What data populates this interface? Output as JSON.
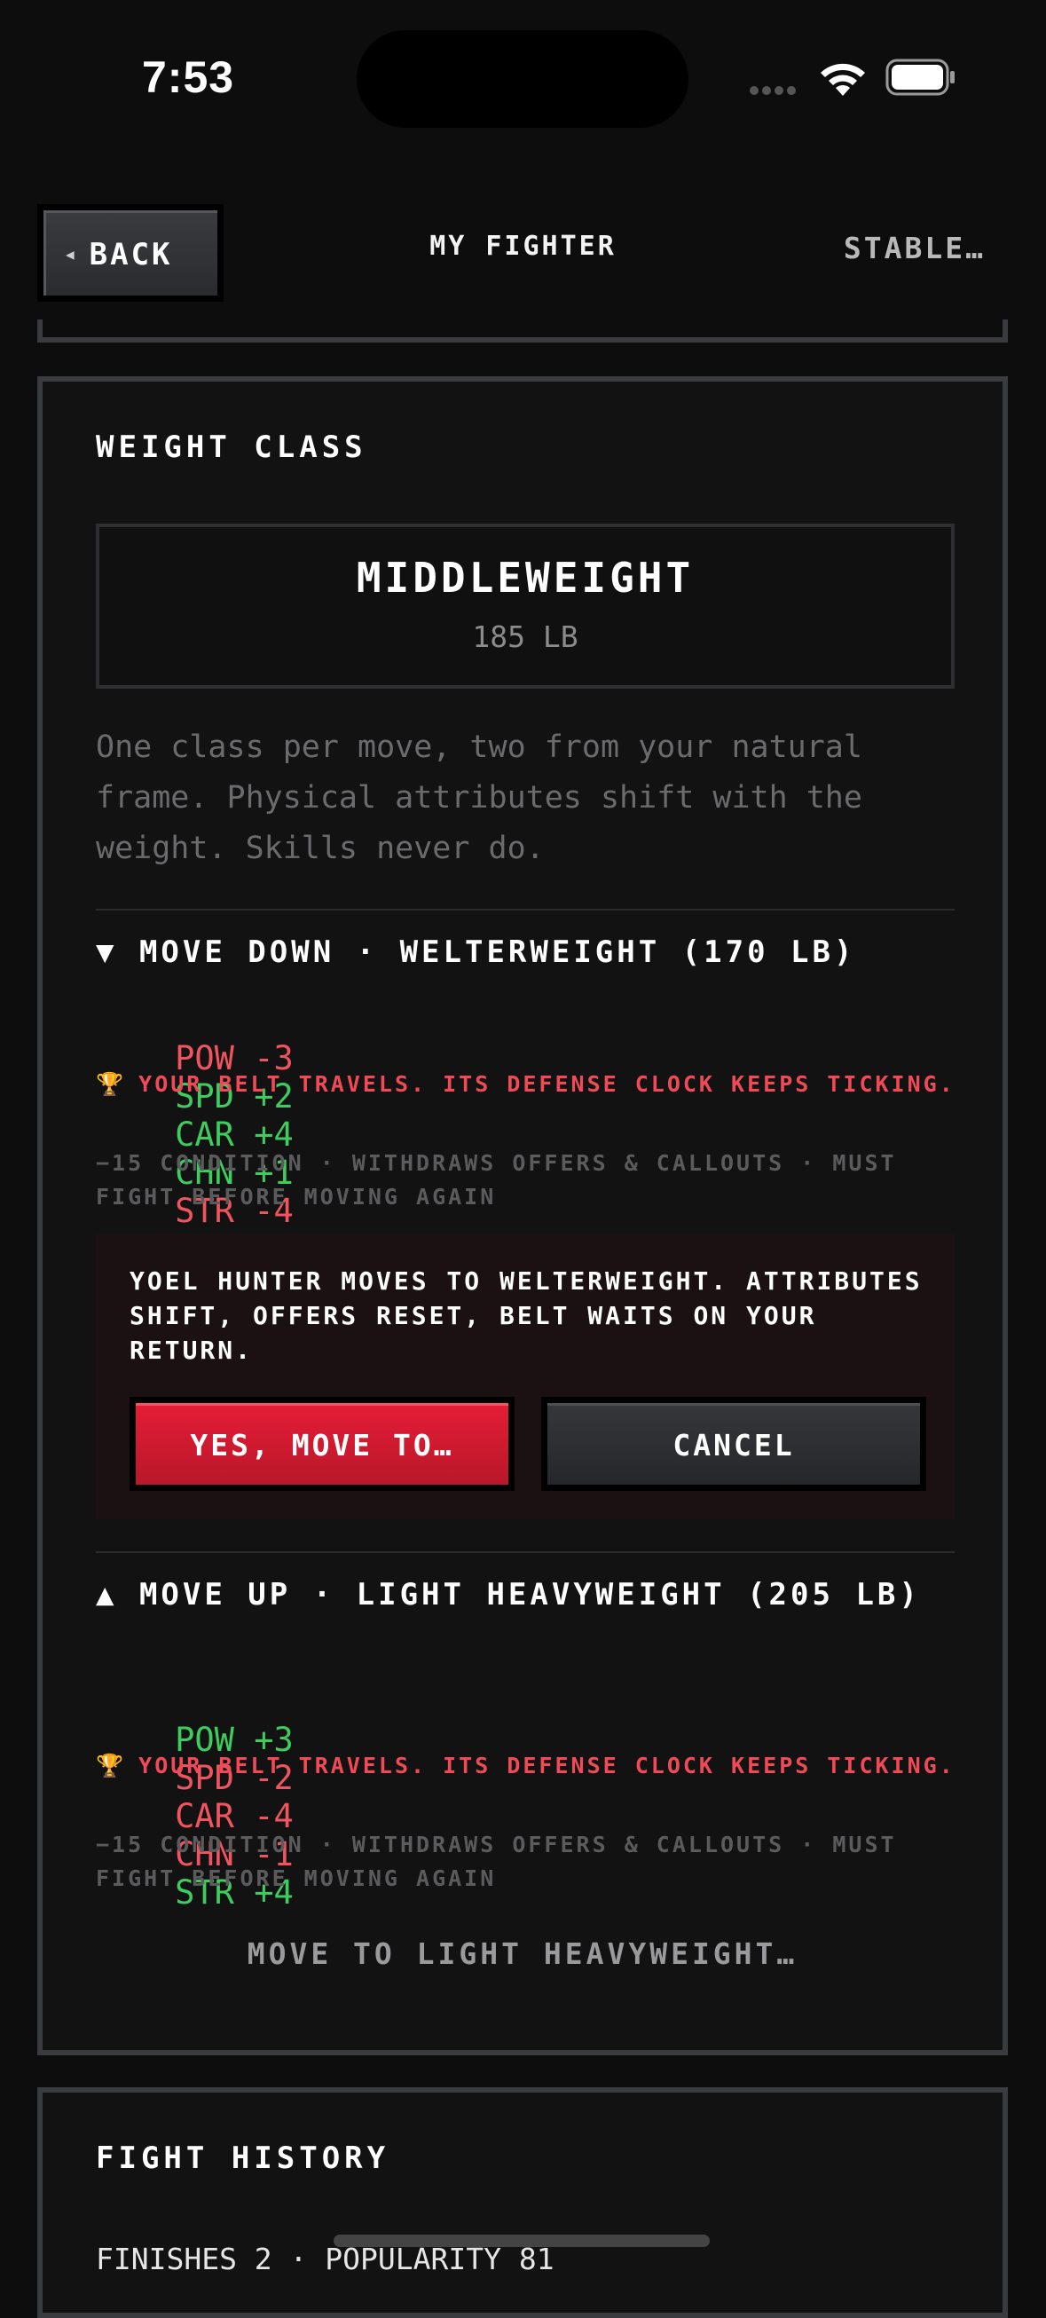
{
  "status_bar": {
    "time": "7:53"
  },
  "nav": {
    "back_label": "BACK",
    "title": "MY FIGHTER",
    "right_label": "STABLE…"
  },
  "weight_class": {
    "title": "WEIGHT CLASS",
    "current_class": "MIDDLEWEIGHT",
    "current_weight": "185 LB",
    "description": "One class per move, two from your natural frame. Physical attributes shift with the weight. Skills never do.",
    "move_down": {
      "heading": "▼ MOVE DOWN · WELTERWEIGHT (170 LB)",
      "attributes": [
        {
          "name": "POW",
          "delta": "-3",
          "sign": "neg"
        },
        {
          "name": "SPD",
          "delta": "+2",
          "sign": "pos"
        },
        {
          "name": "CAR",
          "delta": "+4",
          "sign": "pos"
        },
        {
          "name": "CHN",
          "delta": "+1",
          "sign": "pos"
        },
        {
          "name": "STR",
          "delta": "-4",
          "sign": "neg"
        }
      ],
      "belt_note": "YOUR BELT TRAVELS. ITS DEFENSE CLOCK KEEPS TICKING.",
      "cost_note": "−15 CONDITION · WITHDRAWS OFFERS & CALLOUTS · MUST FIGHT BEFORE MOVING AGAIN"
    },
    "confirm": {
      "message": "YOEL HUNTER MOVES TO WELTERWEIGHT. ATTRIBUTES SHIFT, OFFERS RESET, BELT WAITS ON YOUR RETURN.",
      "confirm_label": "YES, MOVE TO…",
      "cancel_label": "CANCEL"
    },
    "move_up": {
      "heading": "▲ MOVE UP · LIGHT HEAVYWEIGHT (205 LB)",
      "attributes": [
        {
          "name": "POW",
          "delta": "+3",
          "sign": "pos"
        },
        {
          "name": "SPD",
          "delta": "-2",
          "sign": "neg"
        },
        {
          "name": "CAR",
          "delta": "-4",
          "sign": "neg"
        },
        {
          "name": "CHN",
          "delta": "-1",
          "sign": "neg"
        },
        {
          "name": "STR",
          "delta": "+4",
          "sign": "pos"
        }
      ],
      "belt_note": "YOUR BELT TRAVELS. ITS DEFENSE CLOCK KEEPS TICKING.",
      "cost_note": "−15 CONDITION · WITHDRAWS OFFERS & CALLOUTS · MUST FIGHT BEFORE MOVING AGAIN",
      "action_label": "MOVE TO LIGHT HEAVYWEIGHT…"
    }
  },
  "fight_history": {
    "title": "FIGHT HISTORY",
    "stats": "FINISHES 2 · POPULARITY 81"
  },
  "colors": {
    "negative": "#f0555f",
    "positive": "#3ecc5f",
    "accent_red": "#e41d35",
    "trophy": "#e3a72a"
  },
  "icons": {
    "back": "left-triangle-icon",
    "belt": "trophy-icon",
    "signal": "cellular-signal-icon",
    "wifi": "wifi-icon",
    "battery": "battery-icon"
  }
}
